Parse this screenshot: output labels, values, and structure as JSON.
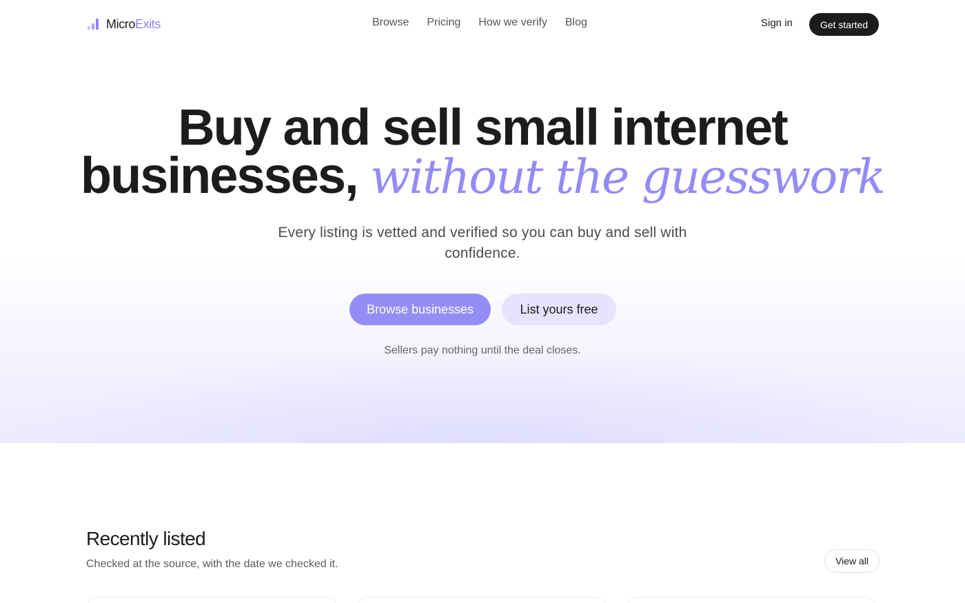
{
  "brand": {
    "name_part1": "Micro",
    "name_part2": "Exits",
    "icon": "bar-chart-icon",
    "accent_color": "#8f86f2"
  },
  "nav": {
    "links": [
      "Browse",
      "Pricing",
      "How we verify",
      "Blog"
    ],
    "sign_in": "Sign in",
    "get_started": "Get started"
  },
  "hero": {
    "headline_line1": "Buy and sell small internet",
    "headline_line2": "businesses,",
    "headline_accent": "without the guesswork",
    "subtitle": "Every listing is vetted and verified so you can buy and sell with confidence.",
    "primary_button": "Browse businesses",
    "secondary_button": "List yours free",
    "note": "Sellers pay nothing until the deal closes."
  },
  "recent": {
    "title": "Recently listed",
    "subtitle": "Checked at the source, with the date we checked it.",
    "view_all": "View all"
  },
  "colors": {
    "primary": "#958df6",
    "secondary_bg": "#e6e3ff",
    "dark": "#1c1c1e"
  }
}
